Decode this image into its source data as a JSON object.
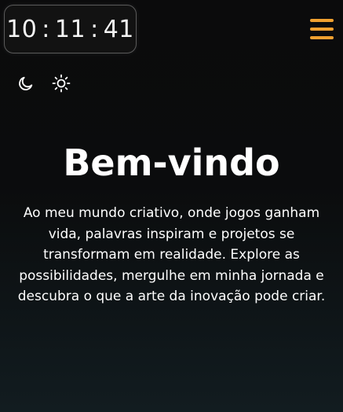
{
  "clock": {
    "hours": "10",
    "minutes": "11",
    "seconds": "41",
    "separator": ":"
  },
  "header": {
    "menu_icon": "hamburger-menu-icon",
    "accent_color": "#f0a030"
  },
  "theme_toggle": {
    "dark_icon": "moon-icon",
    "light_icon": "sun-icon"
  },
  "hero": {
    "title": "Bem-vindo",
    "intro": "Ao meu mundo criativo, onde jogos ganham vida, palavras inspiram e projetos se transformam em realidade. Explore as possibilidades, mergulhe em minha jornada e descubra o que a arte da inovação pode criar."
  }
}
